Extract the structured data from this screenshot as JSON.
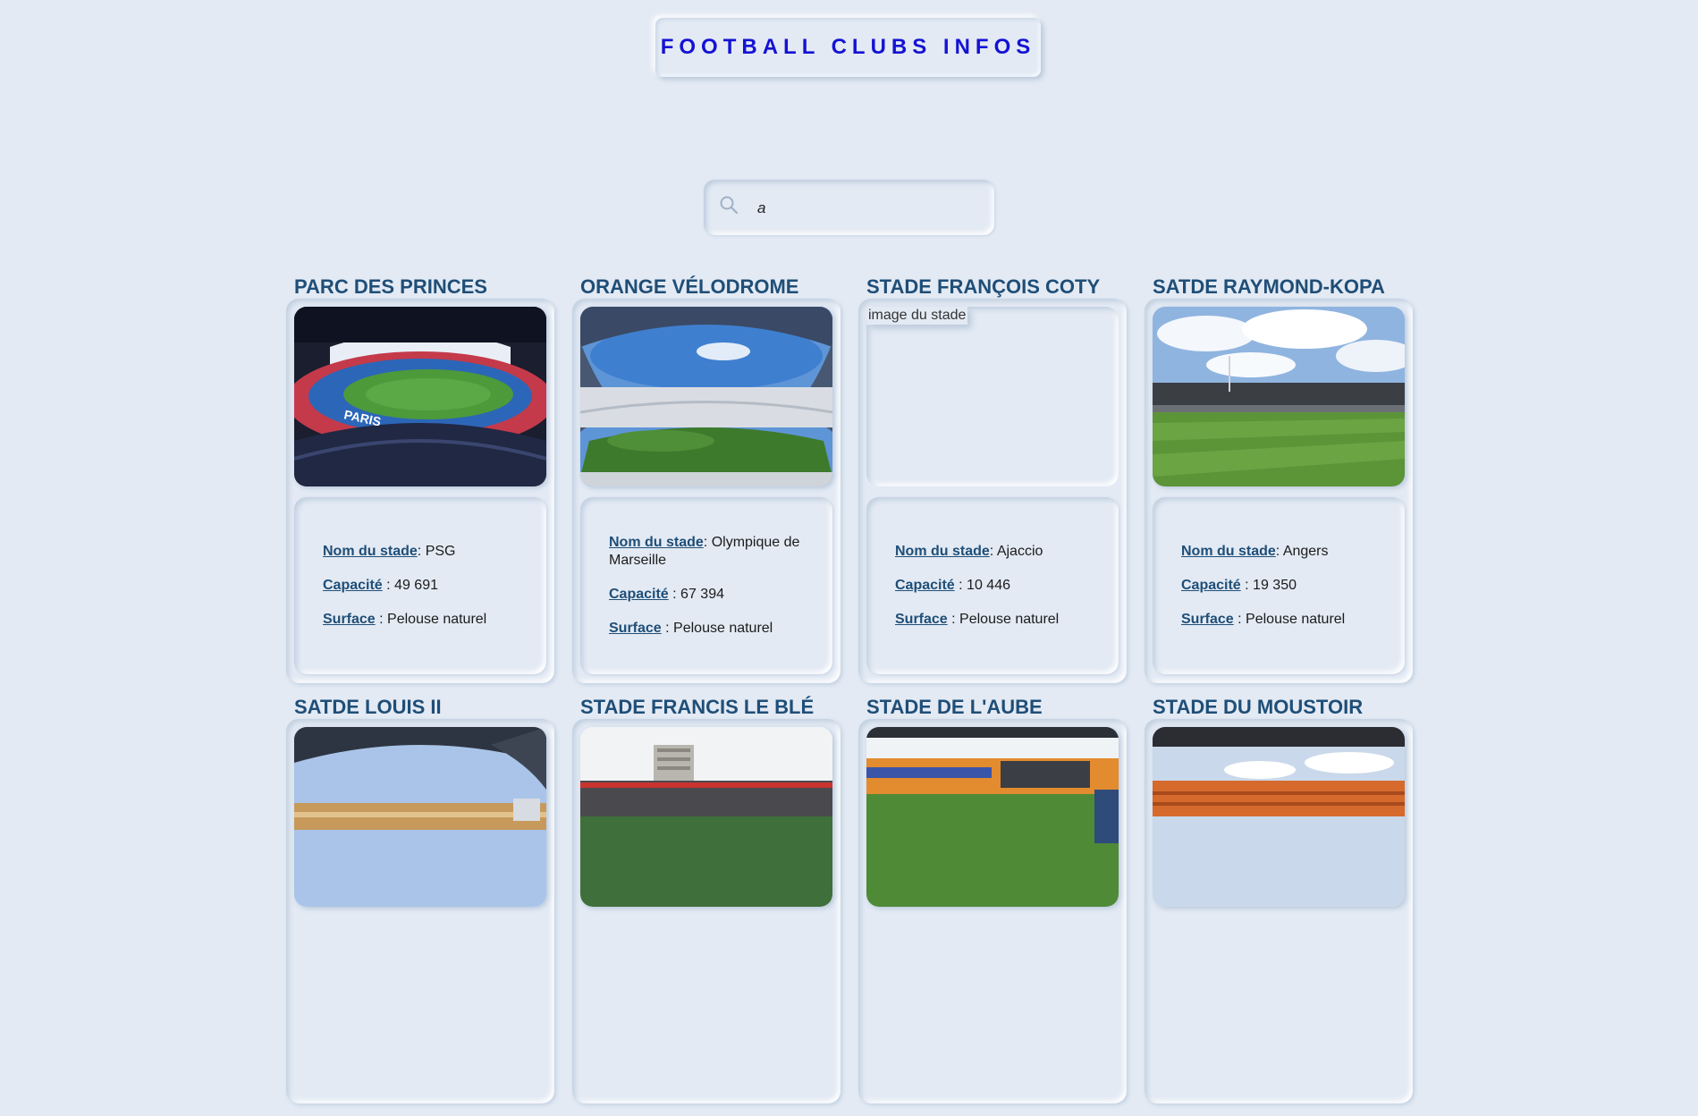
{
  "header": {
    "title": "FOOTBALL CLUBS INFOS"
  },
  "search": {
    "value": "a"
  },
  "labels": {
    "name": "Nom du stade",
    "capacity": "Capacité",
    "surface": "Surface"
  },
  "broken_image_alt": "image du stade",
  "stadiums": [
    {
      "title": "PARC DES PRINCES",
      "club": "PSG",
      "capacity": "49 691",
      "surface": "Pelouse naturel",
      "image": "parc-des-princes-photo"
    },
    {
      "title": "ORANGE VÉLODROME",
      "club": "Olympique de Marseille",
      "capacity": "67 394",
      "surface": "Pelouse naturel",
      "image": "velodrome-photo"
    },
    {
      "title": "STADE FRANÇOIS COTY",
      "club": "Ajaccio",
      "capacity": "10 446",
      "surface": "Pelouse naturel",
      "image": "broken"
    },
    {
      "title": "SATDE RAYMOND-KOPA",
      "club": "Angers",
      "capacity": "19 350",
      "surface": "Pelouse naturel",
      "image": "raymond-kopa-photo"
    },
    {
      "title": "SATDE LOUIS II",
      "image": "louis-ii-photo"
    },
    {
      "title": "STADE FRANCIS LE BLÉ",
      "image": "francis-le-ble-photo"
    },
    {
      "title": "STADE DE L'AUBE",
      "image": "aube-photo"
    },
    {
      "title": "STADE DU MOUSTOIR",
      "image": "moustoir-photo"
    }
  ]
}
